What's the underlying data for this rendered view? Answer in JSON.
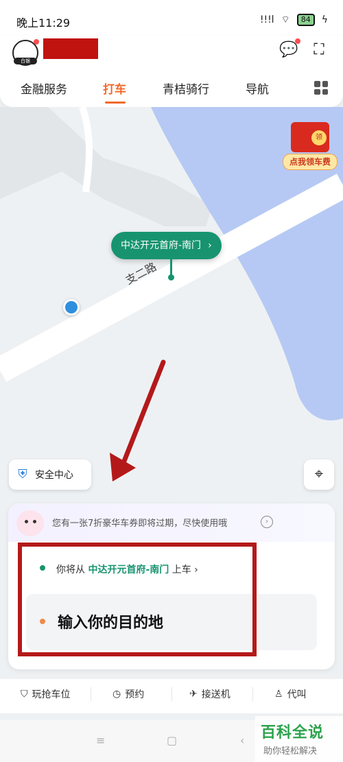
{
  "status_bar": {
    "time": "晚上11:29",
    "signal": "!!!l",
    "wifi": "⌔",
    "battery": "84",
    "charge": "ϟ"
  },
  "header": {
    "avatar_tag": "白银",
    "tabs": [
      "金融服务",
      "打车",
      "青桔骑行",
      "导航"
    ],
    "active_tab": "打车"
  },
  "map": {
    "pickup_bubble": "中达开元首府-南门",
    "road_name": "支二路",
    "red_packet_label": "点我领车费",
    "red_packet_coin": "领"
  },
  "actions": {
    "safety_center": "安全中心"
  },
  "card": {
    "coupon_text": "您有一张7折豪华车券即将过期，尽快使用哦",
    "pickup_prefix": "你将从",
    "pickup_place": "中达开元首府-南门",
    "pickup_suffix": "上车",
    "destination_placeholder": "输入你的目的地"
  },
  "bottom_nav": [
    "玩抢车位",
    "预约",
    "接送机",
    "代叫"
  ],
  "watermark": {
    "title": "百科全说",
    "subtitle": "助你轻松解决"
  },
  "colors": {
    "accent": "#f26a2b",
    "green": "#17946f",
    "river": "#b6c9f4",
    "frame": "#b4191a"
  }
}
